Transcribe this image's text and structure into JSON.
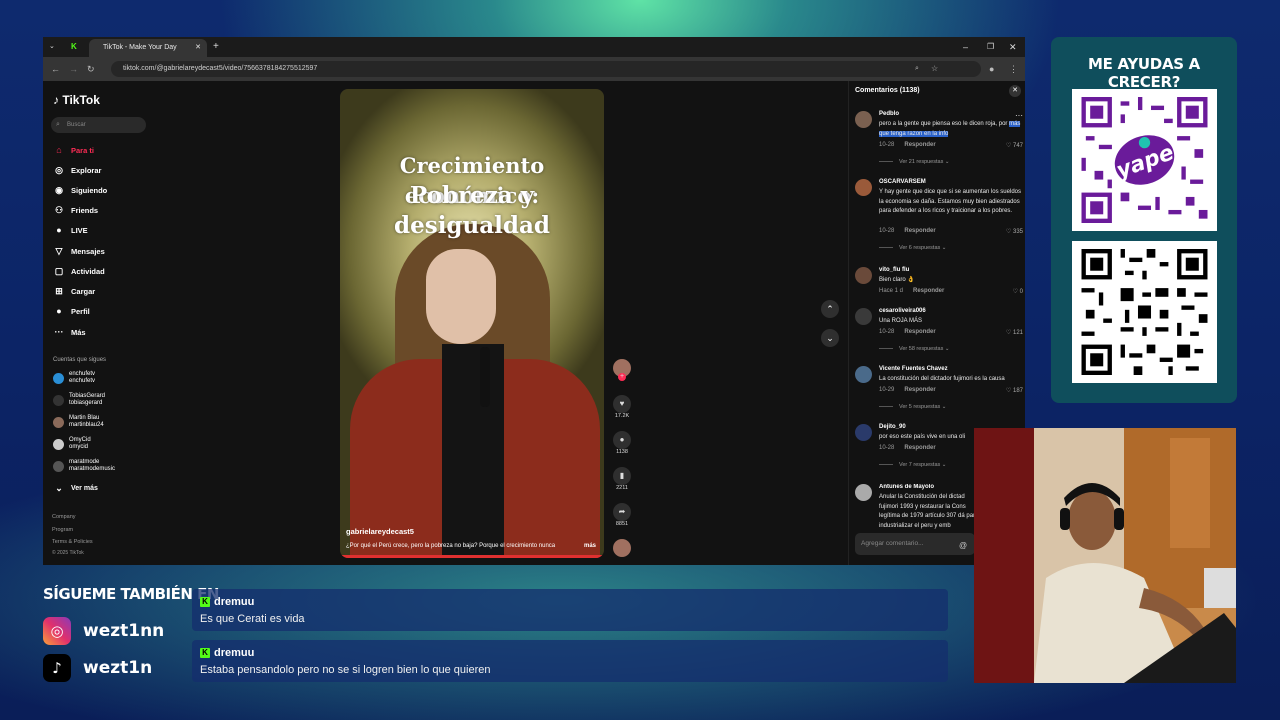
{
  "browser": {
    "tab_title": "TikTok - Make Your Day",
    "url": "tiktok.com/@gabrielareydecast5/video/7566378184275512597"
  },
  "sidebar": {
    "logo": "TikTok",
    "search_placeholder": "Buscar",
    "nav": [
      {
        "label": "Para ti",
        "icon": "home-icon"
      },
      {
        "label": "Explorar",
        "icon": "compass-icon"
      },
      {
        "label": "Siguiendo",
        "icon": "following-icon"
      },
      {
        "label": "Friends",
        "icon": "friends-icon"
      },
      {
        "label": "LIVE",
        "icon": "live-icon"
      },
      {
        "label": "Mensajes",
        "icon": "messages-icon"
      },
      {
        "label": "Actividad",
        "icon": "activity-icon"
      },
      {
        "label": "Cargar",
        "icon": "upload-icon"
      },
      {
        "label": "Perfil",
        "icon": "profile-icon"
      },
      {
        "label": "Más",
        "icon": "more-icon"
      }
    ],
    "following_title": "Cuentas que sigues",
    "accounts": [
      {
        "name": "enchufetv",
        "handle": "enchufetv"
      },
      {
        "name": "TobiasGerard",
        "handle": "tobiasgerard"
      },
      {
        "name": "Martin Blau",
        "handle": "martinblau24"
      },
      {
        "name": "OmyCid",
        "handle": "omycid"
      },
      {
        "name": "maratmode",
        "handle": "maratmodemusic"
      }
    ],
    "see_more": "Ver más",
    "footer": [
      "Company",
      "Program",
      "Terms & Policies",
      "© 2025 TikTok"
    ]
  },
  "video": {
    "title_line1": "Crecimiento económico:",
    "title_line2": "Pobreza y desigualdad",
    "username": "gabrielareydecast5",
    "caption": "¿Por qué el Perú crece, pero la pobreza no baja? Porque el crecimiento nunca",
    "more_label": "más",
    "likes": "17.2K",
    "comments": "1138",
    "saves": "2211",
    "shares": "8851"
  },
  "comments_panel": {
    "title": "Comentarios (1138)",
    "input_placeholder": "Agregar comentario...",
    "reply_label": "Responder",
    "items": [
      {
        "user": "Pedblo",
        "text_a": "pero a la gente que piensa eso le dicen roja, por ",
        "text_hl": "más que tenga razon en la info",
        "date": "10-28",
        "likes": "747",
        "replies": "Ver 21 respuestas"
      },
      {
        "user": "OSCARVARSEM",
        "text": "Y hay gente que dice que si se aumentan los sueldos la economia se daña. Estamos muy bien adiestrados para defender a los ricos y traicionar a los pobres.",
        "date": "10-28",
        "likes": "335",
        "replies": "Ver 6 respuestas"
      },
      {
        "user": "vito_flu flu",
        "text": "Bien claro 👌",
        "date": "Hace 1 d",
        "likes": "0"
      },
      {
        "user": "cesaroliveira006",
        "text": "Una ROJA MÁS",
        "date": "10-28",
        "likes": "121",
        "replies": "Ver 58 respuestas"
      },
      {
        "user": "Vicente Fuentes Chavez",
        "text": "La constitución del dictador fujimori es la causa",
        "date": "10-29",
        "likes": "187",
        "replies": "Ver 5 respuestas"
      },
      {
        "user": "Dejito_90",
        "text": "por eso este país vive en una oli",
        "date": "10-28",
        "replies": "Ver 7 respuestas"
      },
      {
        "user": "Antunes de Mayolo",
        "text": "Anular la Constitución del dictad fujimori 1993 y restaurar la Cons legítima de 1979 artículo 307 dá para industrializar el peru y emb"
      }
    ]
  },
  "qr_panel": {
    "title": "ME AYUDAS A CRECER?",
    "brand": "yape"
  },
  "social": {
    "title": "SÍGUEME TAMBIÉN EN",
    "instagram": "wezt1nn",
    "tiktok": "wezt1n"
  },
  "chat": [
    {
      "user": "dremuu",
      "message": "Es que Cerati es vida"
    },
    {
      "user": "dremuu",
      "message": "Estaba pensandolo pero no se si logren bien lo que quieren"
    }
  ],
  "colors": {
    "accent": "#fe2c55",
    "kick": "#53fc18",
    "highlight": "#2b62c9"
  }
}
